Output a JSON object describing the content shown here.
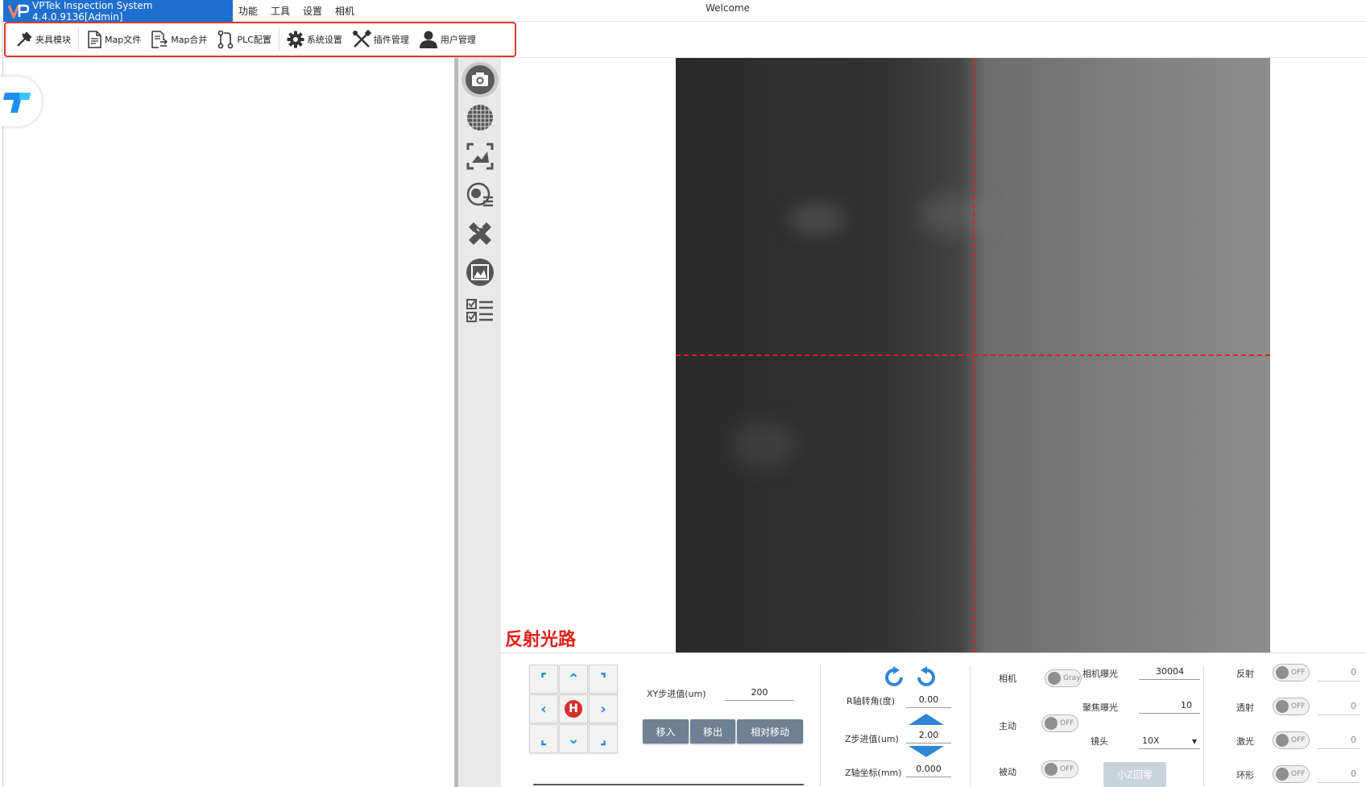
{
  "titlebar": {
    "app_title": "VPTek Inspection System 4.4.0.9136[Admin]",
    "menu": [
      "功能",
      "工具",
      "设置",
      "相机"
    ],
    "welcome": "Welcome"
  },
  "toolbar": {
    "items": [
      {
        "label": "夹具模块",
        "icon": "fixture-icon"
      },
      {
        "label": "Map文件",
        "icon": "document-icon"
      },
      {
        "label": "Map合并",
        "icon": "merge-icon"
      },
      {
        "label": "PLC配置",
        "icon": "plc-icon"
      },
      {
        "label": "系统设置",
        "icon": "gear-icon"
      },
      {
        "label": "插件管理",
        "icon": "tools-icon"
      },
      {
        "label": "用户管理",
        "icon": "user-icon"
      }
    ]
  },
  "toolstrip": {
    "items": [
      "camera-icon",
      "wafer-map-icon",
      "image-adjust-icon",
      "globe-list-icon",
      "ruler-pencil-icon",
      "picture-icon",
      "checklist-icon"
    ],
    "active": "camera-icon"
  },
  "viewer": {
    "path_label": "反射光路"
  },
  "motion": {
    "xy_step_label": "XY步进值(um)",
    "xy_step_value": "200",
    "move_in": "移入",
    "move_out": "移出",
    "relative_move": "相对移动",
    "home_label": "H",
    "r_angle_label": "R轴转角(度)",
    "r_angle_value": "0.00",
    "z_step_label": "Z步进值(um)",
    "z_step_value": "2.00",
    "z_coord_label": "Z轴坐标(mm)",
    "z_coord_value": "0.000"
  },
  "camera": {
    "camera_label": "相机",
    "camera_toggle": "Gray",
    "active_label": "主动",
    "active_toggle": "OFF",
    "passive_label": "被动",
    "passive_toggle": "OFF",
    "exposure_label": "相机曝光",
    "exposure_value": "30004",
    "focus_exposure_label": "聚焦曝光",
    "focus_exposure_value": "10",
    "lens_label": "镜头",
    "lens_value": "10X",
    "small_z_home": "小Z回零"
  },
  "lights": [
    {
      "label": "反射",
      "toggle": "OFF",
      "value": "0"
    },
    {
      "label": "透射",
      "toggle": "OFF",
      "value": "0"
    },
    {
      "label": "激光",
      "toggle": "OFF",
      "value": "0"
    },
    {
      "label": "环形",
      "toggle": "OFF",
      "value": "0"
    }
  ],
  "colors": {
    "accent": "#1f6fd0",
    "highlight": "#e33a2c",
    "crosshair": "#e0201a",
    "button": "#6e8194",
    "arrow": "#1e88e5"
  }
}
